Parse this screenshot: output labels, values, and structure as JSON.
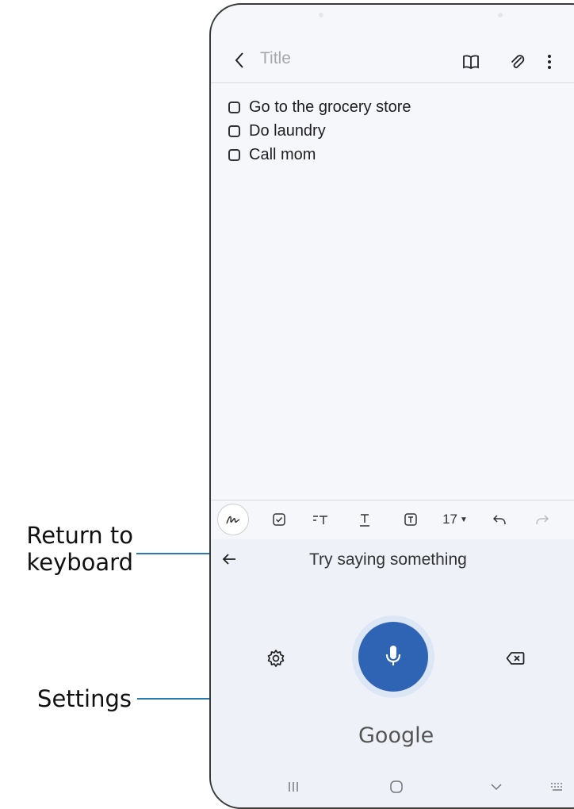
{
  "callouts": {
    "return_to_keyboard": "Return to\nkeyboard",
    "settings": "Settings"
  },
  "note": {
    "title_placeholder": "Title",
    "items": [
      {
        "text": "Go to the grocery store",
        "checked": false
      },
      {
        "text": "Do laundry",
        "checked": false
      },
      {
        "text": "Call mom",
        "checked": false
      }
    ]
  },
  "header_icons": [
    "back-icon",
    "book-icon",
    "attach-icon",
    "more-icon"
  ],
  "toolbar": {
    "font_size": "17"
  },
  "voice": {
    "hint": "Try saying something",
    "brand": "Google"
  },
  "colors": {
    "mic_button": "#2f63b4",
    "callout_line": "#2b7ab0"
  }
}
